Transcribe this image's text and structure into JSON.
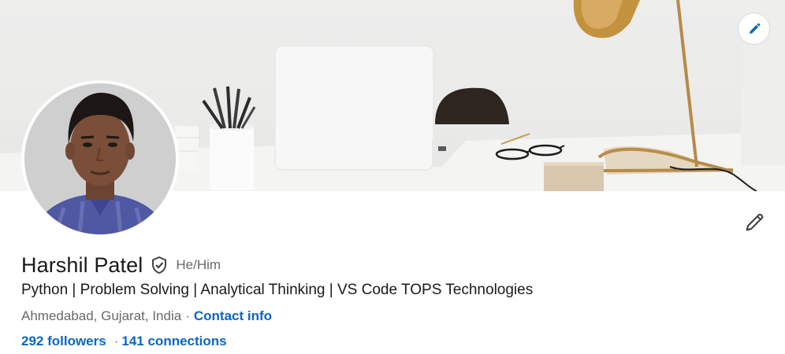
{
  "profile": {
    "name": "Harshil Patel",
    "pronouns": "He/Him",
    "headline": "Python | Problem Solving | Analytical Thinking | VS Code TOPS Technologies",
    "location": "Ahmedabad, Gujarat, India",
    "location_separator": "·",
    "contact_info_label": "Contact info",
    "followers_label": "292 followers",
    "stats_separator": "·",
    "connections_label": "141 connections"
  },
  "icons": {
    "banner_edit": "pencil-icon",
    "profile_edit": "pencil-icon",
    "verified": "shield-check-icon"
  },
  "colors": {
    "link": "#0a66c2",
    "text_primary": "#191919",
    "text_secondary": "#666666"
  }
}
